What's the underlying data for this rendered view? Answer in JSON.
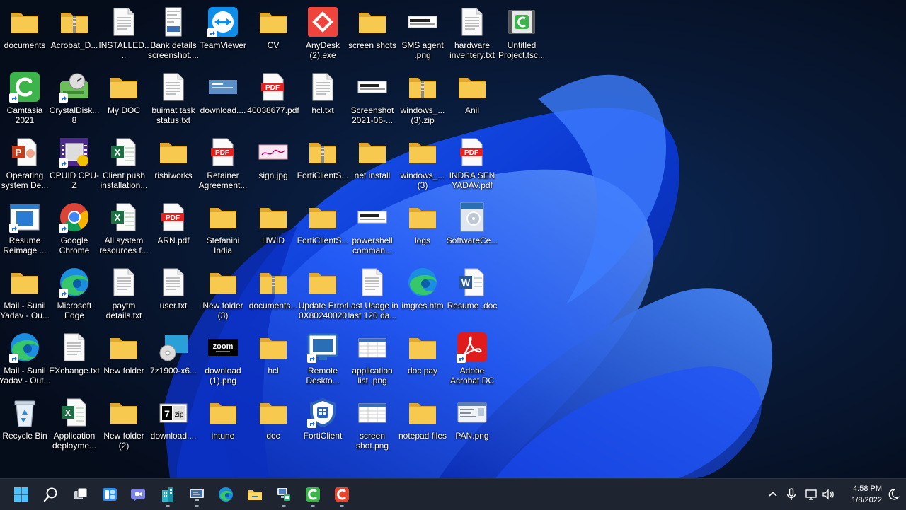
{
  "desktop": {
    "icons": [
      {
        "label": "documents",
        "type": "folder"
      },
      {
        "label": "Acrobat_D...",
        "type": "zipfolder"
      },
      {
        "label": "INSTALLED....",
        "type": "txt"
      },
      {
        "label": "Bank details screenshot....",
        "type": "image-doc"
      },
      {
        "label": "TeamViewer",
        "type": "teamviewer",
        "shortcut": true
      },
      {
        "label": "CV",
        "type": "folder"
      },
      {
        "label": "AnyDesk (2).exe",
        "type": "anydesk"
      },
      {
        "label": "screen shots",
        "type": "folder"
      },
      {
        "label": "SMS agent .png",
        "type": "image-strip"
      },
      {
        "label": "hardware inventery.txt",
        "type": "txt"
      },
      {
        "label": "Untitled Project.tsc...",
        "type": "camtasia-file"
      },
      {
        "label": "Camtasia 2021",
        "type": "camtasia",
        "shortcut": true
      },
      {
        "label": "CrystalDisk... 8",
        "type": "crystaldisk",
        "shortcut": true
      },
      {
        "label": "My DOC",
        "type": "folder"
      },
      {
        "label": "buimat task status.txt",
        "type": "txt"
      },
      {
        "label": "download....",
        "type": "image-blue"
      },
      {
        "label": "40038677.pdf",
        "type": "pdf"
      },
      {
        "label": "hcl.txt",
        "type": "txt"
      },
      {
        "label": "Screenshot 2021-06-...",
        "type": "image-strip"
      },
      {
        "label": "windows_... (3).zip",
        "type": "zipfolder"
      },
      {
        "label": "Anil",
        "type": "folder"
      },
      {
        "label": "Operating system De...",
        "type": "ppt"
      },
      {
        "label": "CPUID CPU-Z",
        "type": "cpuz",
        "shortcut": true
      },
      {
        "label": "Client push installation...",
        "type": "excel"
      },
      {
        "label": "rishiworks",
        "type": "folder"
      },
      {
        "label": "Retainer Agreement...",
        "type": "pdf"
      },
      {
        "label": "sign.jpg",
        "type": "image-pink"
      },
      {
        "label": "FortiClientS...",
        "type": "zipfolder"
      },
      {
        "label": "net install",
        "type": "folder"
      },
      {
        "label": "windows_... (3)",
        "type": "folder"
      },
      {
        "label": "INDRA SEN YADAV.pdf",
        "type": "pdf"
      },
      {
        "label": "Resume Reimage ...",
        "type": "reimage",
        "shortcut": true
      },
      {
        "label": "Google Chrome",
        "type": "chrome",
        "shortcut": true
      },
      {
        "label": "All system resources f...",
        "type": "excel"
      },
      {
        "label": "ARN.pdf",
        "type": "pdf"
      },
      {
        "label": "Stefanini India",
        "type": "folder"
      },
      {
        "label": "HWID",
        "type": "folder"
      },
      {
        "label": "FortiClientS...",
        "type": "folder"
      },
      {
        "label": "powershell comman...",
        "type": "image-strip"
      },
      {
        "label": "logs",
        "type": "folder"
      },
      {
        "label": "SoftwareCe...",
        "type": "softwarecenter"
      },
      {
        "label": "Mail - Sunil Yadav - Ou...",
        "type": "folder"
      },
      {
        "label": "Microsoft Edge",
        "type": "edge",
        "shortcut": true
      },
      {
        "label": "paytm details.txt",
        "type": "txt"
      },
      {
        "label": "user.txt",
        "type": "txt"
      },
      {
        "label": "New folder (3)",
        "type": "folder"
      },
      {
        "label": "documents...",
        "type": "zipfolder"
      },
      {
        "label": "Update Error 0X80240020",
        "type": "folder"
      },
      {
        "label": "Last Usage in last 120 da...",
        "type": "txt"
      },
      {
        "label": "imgres.htm",
        "type": "edge"
      },
      {
        "label": "Resume .doc",
        "type": "word"
      },
      {
        "label": "Mail - Sunil Yadav - Out...",
        "type": "edge",
        "shortcut": true
      },
      {
        "label": "EXchange.txt",
        "type": "txt"
      },
      {
        "label": "New folder",
        "type": "folder"
      },
      {
        "label": "7z1900-x6...",
        "type": "installer"
      },
      {
        "label": "download (1).png",
        "type": "zoom"
      },
      {
        "label": "hcl",
        "type": "folder"
      },
      {
        "label": "Remote Deskto...",
        "type": "rdp",
        "shortcut": true
      },
      {
        "label": "application list .png",
        "type": "image-table"
      },
      {
        "label": "doc pay",
        "type": "folder"
      },
      {
        "label": "Adobe Acrobat DC",
        "type": "acrobat",
        "shortcut": true
      },
      {
        "label": "Recycle Bin",
        "type": "recycle"
      },
      {
        "label": "Application deployme...",
        "type": "excel"
      },
      {
        "label": "New folder (2)",
        "type": "folder"
      },
      {
        "label": "download....",
        "type": "sevenzip"
      },
      {
        "label": "intune",
        "type": "folder"
      },
      {
        "label": "doc",
        "type": "folder"
      },
      {
        "label": "FortiClient",
        "type": "forticlient",
        "shortcut": true
      },
      {
        "label": "screen shot.png",
        "type": "image-table"
      },
      {
        "label": "notepad files",
        "type": "folder"
      },
      {
        "label": "PAN.png",
        "type": "image-card"
      }
    ]
  },
  "taskbar": {
    "apps": [
      {
        "name": "start-button",
        "icon": "windows-logo",
        "running": false
      },
      {
        "name": "search-button",
        "icon": "search-icon",
        "running": false
      },
      {
        "name": "task-view-button",
        "icon": "task-view-icon",
        "running": false
      },
      {
        "name": "widgets-button",
        "icon": "widgets-icon",
        "running": false
      },
      {
        "name": "teams-chat-button",
        "icon": "teams-icon",
        "running": false
      },
      {
        "name": "app-button-1",
        "icon": "building-app-icon",
        "running": true
      },
      {
        "name": "app-button-2",
        "icon": "remote-pc-icon",
        "running": true
      },
      {
        "name": "edge-button",
        "icon": "edge-icon",
        "running": false
      },
      {
        "name": "file-explorer-button",
        "icon": "folder-icon",
        "running": false
      },
      {
        "name": "app-button-3",
        "icon": "network-pc-icon",
        "running": true
      },
      {
        "name": "camtasia-button",
        "icon": "camtasia-icon",
        "running": true
      },
      {
        "name": "camtasia-recorder-button",
        "icon": "camtasia-recorder-icon",
        "running": true
      }
    ],
    "tray": [
      "chevron-up-icon",
      "microphone-icon",
      "network-icon",
      "volume-icon"
    ],
    "time": "4:58 PM",
    "date": "1/8/2022"
  },
  "colors": {
    "folder": "#f7c94f",
    "taskbar": "#1e2531",
    "accent": "#3a8ee6"
  }
}
